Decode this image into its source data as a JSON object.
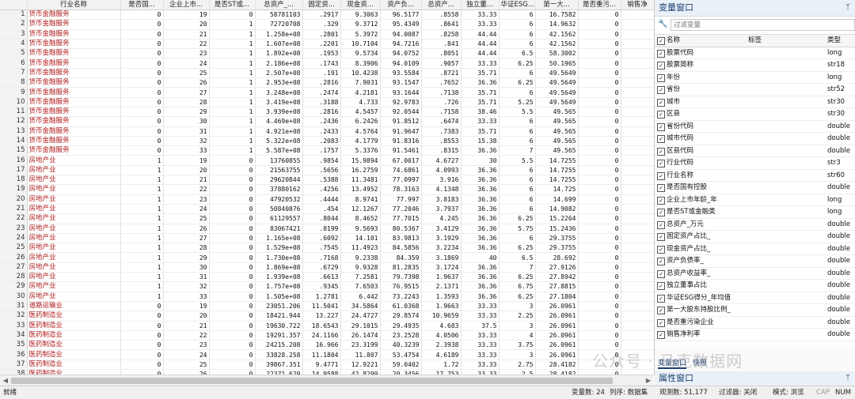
{
  "grid": {
    "columns": [
      "",
      "行业名称",
      "是否国...",
      "企业上市...",
      "是否ST或...",
      "总资产_...",
      "固定资...",
      "现金资...",
      "资产负...",
      "总资产...",
      "独立董...",
      "华证ESG...",
      "第一大...",
      "是否重污...",
      "销售净"
    ],
    "rows": [
      [
        "1",
        "货币金融服务",
        "0",
        "19",
        "0",
        "58781103",
        ".2917",
        "9.3063",
        "96.5177",
        ".8558",
        "33.33",
        "6",
        "16.7582",
        "0",
        ""
      ],
      [
        "2",
        "货币金融服务",
        "0",
        "20",
        "1",
        "72720708",
        ".329",
        "9.3712",
        "95.4349",
        ".8641",
        "33.33",
        "6",
        "14.9632",
        "0",
        ""
      ],
      [
        "3",
        "货币金融服务",
        "0",
        "21",
        "1",
        "1.258e+08",
        ".2801",
        "5.3972",
        "94.0087",
        ".8258",
        "44.44",
        "6",
        "42.1562",
        "0",
        ""
      ],
      [
        "4",
        "货币金融服务",
        "0",
        "22",
        "1",
        "1.607e+08",
        ".2201",
        "10.7104",
        "94.7216",
        ".841",
        "44.44",
        "6",
        "42.1562",
        "0",
        ""
      ],
      [
        "5",
        "货币金融服务",
        "0",
        "23",
        "1",
        "1.892e+08",
        ".1953",
        "9.5734",
        "94.0752",
        ".8051",
        "44.44",
        "6.5",
        "58.3002",
        "0",
        ""
      ],
      [
        "6",
        "货币金融服务",
        "0",
        "24",
        "1",
        "2.186e+08",
        ".1743",
        "8.3906",
        "94.0109",
        ".9057",
        "33.33",
        "6.25",
        "50.1965",
        "0",
        ""
      ],
      [
        "7",
        "货币金融服务",
        "0",
        "25",
        "1",
        "2.507e+08",
        ".191",
        "10.4238",
        "93.5584",
        ".8721",
        "35.71",
        "6",
        "49.5649",
        "0",
        ""
      ],
      [
        "8",
        "货币金融服务",
        "0",
        "26",
        "1",
        "2.953e+08",
        ".2816",
        "7.9031",
        "93.1547",
        ".7652",
        "36.36",
        "6.25",
        "49.5649",
        "0",
        ""
      ],
      [
        "9",
        "货币金融服务",
        "0",
        "27",
        "1",
        "3.248e+08",
        ".2474",
        "4.2181",
        "93.1644",
        ".7138",
        "35.71",
        "6",
        "49.5649",
        "0",
        ""
      ],
      [
        "10",
        "货币金融服务",
        "0",
        "28",
        "1",
        "3.419e+08",
        ".3188",
        "4.733",
        "92.9783",
        ".726",
        "35.71",
        "5.25",
        "49.5649",
        "0",
        ""
      ],
      [
        "11",
        "货币金融服务",
        "0",
        "29",
        "1",
        "3.939e+08",
        ".2816",
        "4.5457",
        "92.0544",
        ".7158",
        "38.46",
        "5.5",
        "49.565",
        "0",
        ""
      ],
      [
        "12",
        "货币金融服务",
        "0",
        "30",
        "1",
        "4.469e+08",
        ".2436",
        "6.2426",
        "91.8512",
        ".6474",
        "33.33",
        "6",
        "49.565",
        "0",
        ""
      ],
      [
        "13",
        "货币金融服务",
        "0",
        "31",
        "1",
        "4.921e+08",
        ".2433",
        "4.5764",
        "91.9647",
        ".7383",
        "35.71",
        "6",
        "49.565",
        "0",
        ""
      ],
      [
        "14",
        "货币金融服务",
        "0",
        "32",
        "1",
        "5.322e+08",
        ".2083",
        "4.1779",
        "91.8316",
        ".8553",
        "15.38",
        "6",
        "49.565",
        "0",
        ""
      ],
      [
        "15",
        "货币金融服务",
        "0",
        "33",
        "1",
        "5.587e+08",
        ".1757",
        "5.3376",
        "91.5461",
        ".8315",
        "36.36",
        "7",
        "49.565",
        "0",
        ""
      ],
      [
        "16",
        "房地产业",
        "1",
        "19",
        "0",
        "13760855",
        ".9854",
        "15.9894",
        "67.0017",
        "4.6727",
        "30",
        "5.5",
        "14.7255",
        "0",
        ""
      ],
      [
        "17",
        "房地产业",
        "1",
        "20",
        "0",
        "21563755",
        ".5656",
        "16.2759",
        "74.6861",
        "4.0993",
        "36.36",
        "6",
        "14.7255",
        "0",
        ""
      ],
      [
        "18",
        "房地产业",
        "1",
        "21",
        "0",
        "29620844",
        ".5388",
        "11.3481",
        "77.0997",
        "3.916",
        "36.36",
        "6",
        "14.7255",
        "0",
        ""
      ],
      [
        "19",
        "房地产业",
        "1",
        "22",
        "0",
        "37880162",
        ".4256",
        "13.4952",
        "78.3163",
        "4.1348",
        "36.36",
        "6",
        "14.725",
        "0",
        ""
      ],
      [
        "20",
        "房地产业",
        "1",
        "23",
        "0",
        "47920532",
        ".4444",
        "8.9741",
        "77.997",
        "3.8183",
        "36.36",
        "6",
        "14.699",
        "0",
        ""
      ],
      [
        "21",
        "房地产业",
        "1",
        "24",
        "0",
        "50840876",
        ".454",
        "12.1267",
        "77.2046",
        "3.7937",
        "36.36",
        "6",
        "14.9082",
        "0",
        ""
      ],
      [
        "22",
        "房地产业",
        "1",
        "25",
        "0",
        "61129557",
        ".8044",
        "8.4652",
        "77.7015",
        "4.245",
        "36.36",
        "6.25",
        "15.2264",
        "0",
        ""
      ],
      [
        "23",
        "房地产业",
        "1",
        "26",
        "0",
        "83067421",
        ".8199",
        "9.5693",
        "80.5367",
        "3.4129",
        "36.36",
        "5.75",
        "15.2436",
        "0",
        ""
      ],
      [
        "24",
        "房地产业",
        "1",
        "27",
        "0",
        "1.165e+08",
        ".6092",
        "14.101",
        "83.9813",
        "3.1929",
        "36.36",
        "6",
        "29.3755",
        "0",
        ""
      ],
      [
        "25",
        "房地产业",
        "1",
        "28",
        "0",
        "1.529e+08",
        ".7545",
        "11.4923",
        "84.5856",
        "3.2234",
        "36.36",
        "6.25",
        "29.3755",
        "0",
        ""
      ],
      [
        "26",
        "房地产业",
        "1",
        "29",
        "0",
        "1.730e+08",
        ".7168",
        "9.2338",
        "84.359",
        "3.1869",
        "40",
        "6.5",
        "28.692",
        "0",
        ""
      ],
      [
        "27",
        "房地产业",
        "1",
        "30",
        "0",
        "1.869e+08",
        ".6729",
        "9.9328",
        "81.2835",
        "3.1724",
        "36.36",
        "7",
        "27.9126",
        "0",
        ""
      ],
      [
        "28",
        "房地产业",
        "1",
        "31",
        "0",
        "1.939e+08",
        ".6613",
        "7.2581",
        "79.7398",
        "1.9637",
        "36.36",
        "6.25",
        "27.8942",
        "0",
        ""
      ],
      [
        "29",
        "房地产业",
        "1",
        "32",
        "0",
        "1.757e+08",
        ".9345",
        "7.6503",
        "76.9515",
        "2.1371",
        "36.36",
        "6.75",
        "27.8815",
        "0",
        ""
      ],
      [
        "30",
        "房地产业",
        "1",
        "33",
        "0",
        "1.505e+08",
        "1.2781",
        "6.442",
        "73.2243",
        "1.3593",
        "36.36",
        "6.25",
        "27.1804",
        "0",
        ""
      ],
      [
        "31",
        "道路运输业",
        "0",
        "19",
        "0",
        "23051.206",
        "11.5041",
        "34.5864",
        "61.0368",
        "1.9663",
        "33.33",
        "3",
        "26.0961",
        "0",
        ""
      ],
      [
        "32",
        "医药制造业",
        "0",
        "20",
        "0",
        "18421.944",
        "13.227",
        "24.4727",
        "29.8574",
        "10.9659",
        "33.33",
        "2.25",
        "26.0961",
        "0",
        ""
      ],
      [
        "33",
        "医药制造业",
        "0",
        "21",
        "0",
        "19630.722",
        "18.6543",
        "29.1015",
        "29.4935",
        "4.683",
        "37.5",
        "3",
        "26.0961",
        "0",
        ""
      ],
      [
        "34",
        "医药制造业",
        "0",
        "22",
        "0",
        "19291.357",
        "24.1166",
        "26.1474",
        "23.2528",
        "4.0506",
        "33.33",
        "4",
        "26.0961",
        "0",
        ""
      ],
      [
        "35",
        "医药制造业",
        "0",
        "23",
        "0",
        "24215.208",
        "16.966",
        "23.3199",
        "40.3239",
        "2.3938",
        "33.33",
        "3.75",
        "26.0961",
        "0",
        ""
      ],
      [
        "36",
        "医药制造业",
        "0",
        "24",
        "0",
        "33828.258",
        "11.1804",
        "11.807",
        "53.4754",
        "4.6189",
        "33.33",
        "3",
        "26.0961",
        "0",
        ""
      ],
      [
        "37",
        "医药制造业",
        "0",
        "25",
        "0",
        "39867.351",
        "9.4771",
        "12.9221",
        "59.0402",
        "1.72",
        "33.33",
        "2.75",
        "28.4182",
        "0",
        ""
      ],
      [
        "38",
        "医药制造业",
        "0",
        "26",
        "0",
        "22371.629",
        "14.9588",
        "42.8299",
        "20.3456",
        "17.753",
        "33.33",
        "2.5",
        "28.4182",
        "0",
        ""
      ],
      [
        "39",
        "医药制造业",
        "0",
        "27",
        "0",
        "26884.43",
        "11.613",
        "37.2321",
        "31.5247",
        "2.1917",
        "33.33",
        "2.5",
        "28.4327",
        "0",
        ""
      ]
    ]
  },
  "variables": {
    "title": "变量窗口",
    "filter_placeholder": "过滤变量",
    "headers": {
      "name": "名称",
      "label": "标签",
      "type": "类型"
    },
    "items": [
      {
        "name": "股票代码",
        "label": "",
        "type": "long"
      },
      {
        "name": "股票简称",
        "label": "",
        "type": "str18"
      },
      {
        "name": "年份",
        "label": "",
        "type": "long"
      },
      {
        "name": "省份",
        "label": "",
        "type": "str52"
      },
      {
        "name": "城市",
        "label": "",
        "type": "str30"
      },
      {
        "name": "区县",
        "label": "",
        "type": "str30"
      },
      {
        "name": "省份代码",
        "label": "",
        "type": "double"
      },
      {
        "name": "城市代码",
        "label": "",
        "type": "double"
      },
      {
        "name": "区县代码",
        "label": "",
        "type": "double"
      },
      {
        "name": "行业代码",
        "label": "",
        "type": "str3"
      },
      {
        "name": "行业名称",
        "label": "",
        "type": "str60"
      },
      {
        "name": "是否国有控股",
        "label": "",
        "type": "double"
      },
      {
        "name": "企业上市年龄_年",
        "label": "",
        "type": "long"
      },
      {
        "name": "是否ST或金融类",
        "label": "",
        "type": "long"
      },
      {
        "name": "总资产_万元",
        "label": "",
        "type": "double"
      },
      {
        "name": "固定资产占比_",
        "label": "",
        "type": "double"
      },
      {
        "name": "现金资产占比_",
        "label": "",
        "type": "double"
      },
      {
        "name": "资产负债率_",
        "label": "",
        "type": "double"
      },
      {
        "name": "总资产收益率_",
        "label": "",
        "type": "double"
      },
      {
        "name": "独立董事占比",
        "label": "",
        "type": "double"
      },
      {
        "name": "华证ESG得分_年均值",
        "label": "",
        "type": "double"
      },
      {
        "name": "第一大股东持股比例_",
        "label": "",
        "type": "double"
      },
      {
        "name": "是否重污染企业",
        "label": "",
        "type": "double"
      },
      {
        "name": "销售净利率",
        "label": "",
        "type": "double"
      }
    ],
    "tabs": [
      "变量窗口",
      "快照"
    ],
    "props_title": "属性窗口",
    "pin_icon": "pin-icon"
  },
  "status": {
    "ready": "就绪",
    "vars": "变量数: 24",
    "order": "列序: 数据集",
    "obs": "观测数: 51,177",
    "filter": "过滤器: 关闭",
    "mode": "模式: 浏览",
    "cap": "CAP",
    "num": "NUM"
  },
  "watermark": "公众号 · 马克数据网"
}
